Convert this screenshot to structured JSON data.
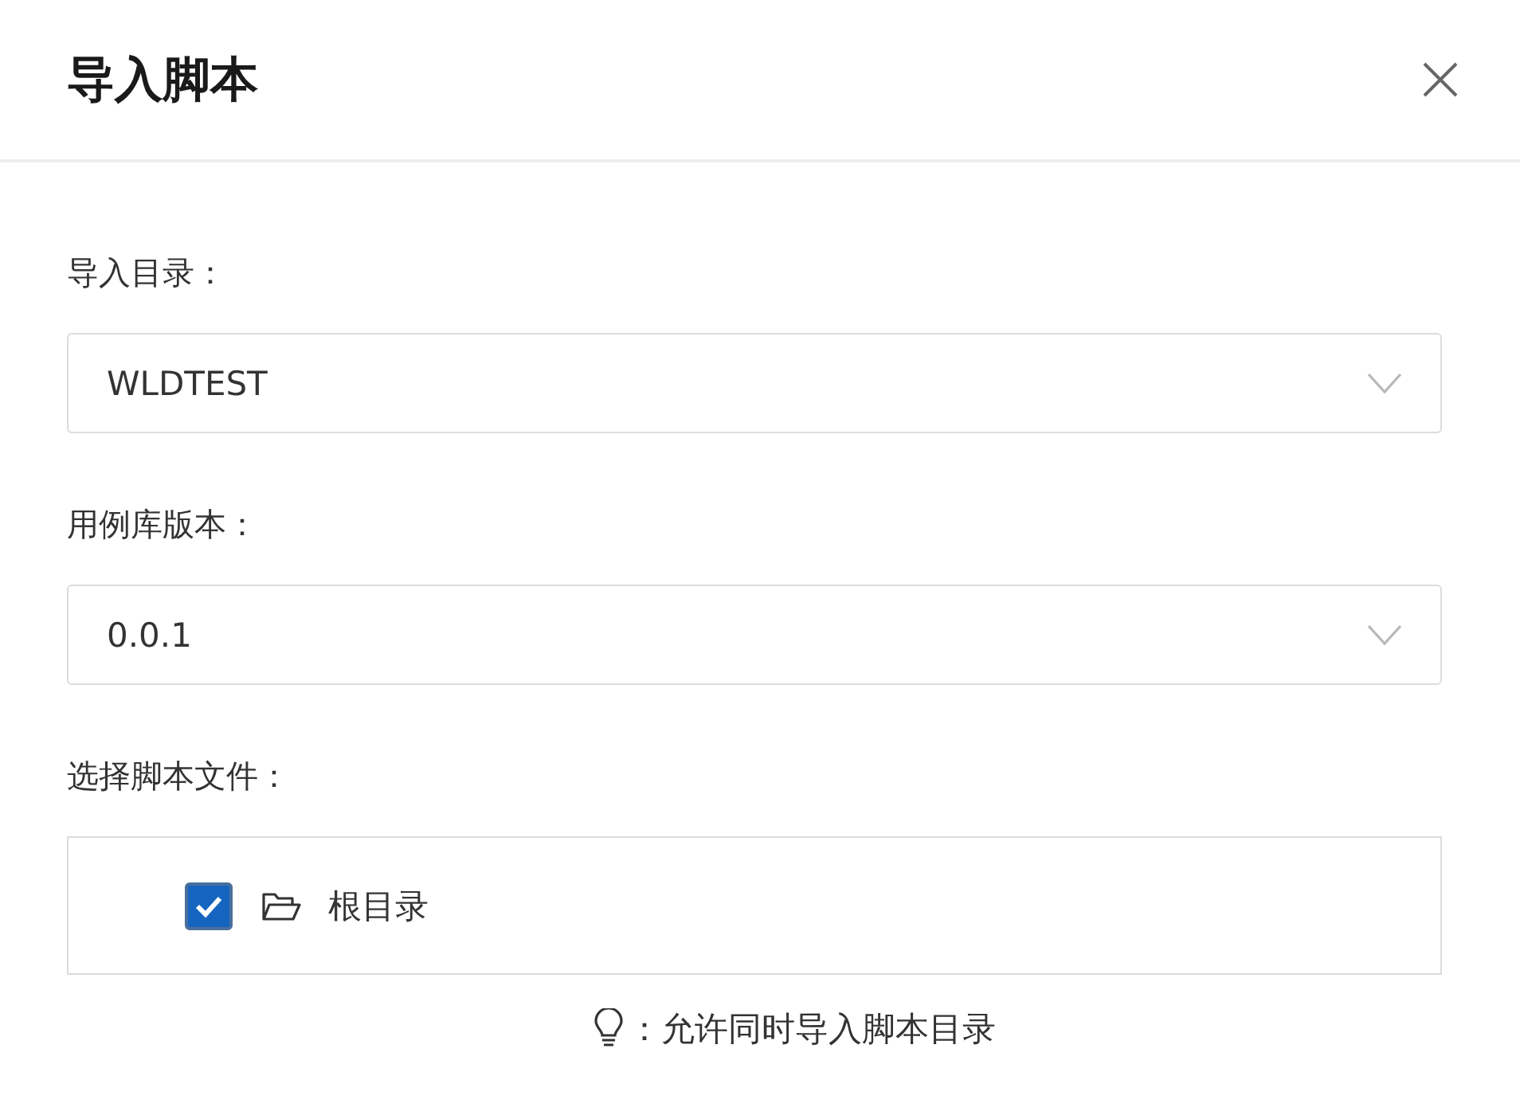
{
  "dialog": {
    "title": "导入脚本"
  },
  "fields": [
    {
      "label": "导入目录：",
      "value": "WLDTEST"
    },
    {
      "label": "用例库版本：",
      "value": "0.0.1"
    }
  ],
  "file_tree": {
    "label": "选择脚本文件：",
    "items": [
      {
        "label": "根目录",
        "checked": true
      }
    ]
  },
  "hint": "：允许同时导入脚本目录"
}
